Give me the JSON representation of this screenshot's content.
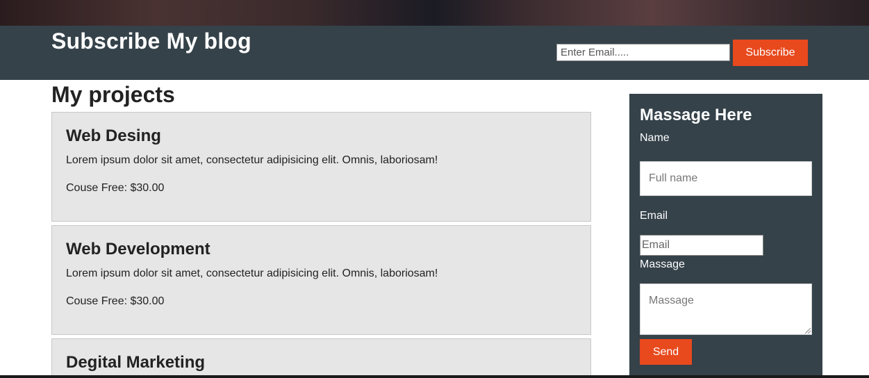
{
  "subscribe": {
    "title": "Subscribe My blog",
    "email_placeholder": "Enter Email.....",
    "button_label": "Subscribe"
  },
  "projects": {
    "heading": "My projects",
    "items": [
      {
        "title": "Web Desing",
        "description": "Lorem ipsum dolor sit amet, consectetur adipisicing elit. Omnis, laboriosam!",
        "price": "Couse Free: $30.00"
      },
      {
        "title": "Web Development",
        "description": "Lorem ipsum dolor sit amet, consectetur adipisicing elit. Omnis, laboriosam!",
        "price": "Couse Free: $30.00"
      },
      {
        "title": "Degital Marketing",
        "description": "",
        "price": ""
      }
    ]
  },
  "message_form": {
    "title": "Massage Here",
    "name_label": "Name",
    "name_placeholder": "Full name",
    "email_label": "Email",
    "email_placeholder": "Email",
    "message_label": "Massage",
    "message_placeholder": "Massage",
    "send_label": "Send"
  },
  "colors": {
    "header_bg": "#35424a",
    "accent": "#e8491d",
    "card_bg": "#e6e6e6"
  }
}
